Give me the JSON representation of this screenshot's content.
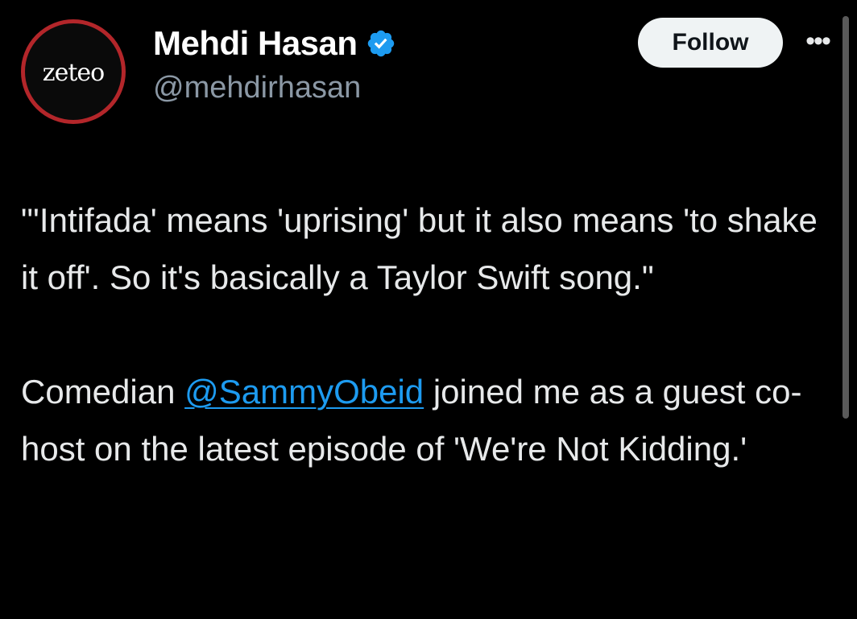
{
  "author": {
    "avatar_text": "zeteo",
    "display_name": "Mehdi Hasan",
    "handle": "@mehdirhasan",
    "verified_icon": "verified-badge-icon"
  },
  "actions": {
    "follow_label": "Follow",
    "more_label": "•••"
  },
  "tweet": {
    "paragraph1": "\"'Intifada' means 'uprising' but it also means 'to shake it off'. So it's basically a Taylor Swift song.\"",
    "paragraph2_before": "Comedian ",
    "mention": "@SammyObeid",
    "paragraph2_after": " joined me as a guest co-host on the latest episode of 'We're Not Kidding.'"
  },
  "colors": {
    "background": "#000000",
    "text": "#e7e9ea",
    "secondary_text": "#8b98a5",
    "link": "#1d9bf0",
    "verified": "#1d9bf0",
    "avatar_ring": "#b3262a",
    "follow_button_bg": "#eff3f4"
  }
}
